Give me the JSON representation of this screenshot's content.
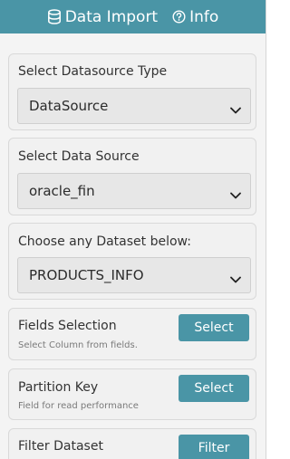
{
  "header": {
    "data_import_label": "Data Import",
    "info_label": "Info",
    "accent_color": "#4a95a6"
  },
  "datasource_type": {
    "label": "Select Datasource Type",
    "selected": "DataSource"
  },
  "data_source": {
    "label": "Select Data Source",
    "selected": "oracle_fin"
  },
  "dataset": {
    "label": "Choose any Dataset below:",
    "selected": "PRODUCTS_INFO"
  },
  "fields_selection": {
    "title": "Fields Selection",
    "subtitle": "Select Column from fields.",
    "button_label": "Select"
  },
  "partition_key": {
    "title": "Partition Key",
    "subtitle": "Field for read performance",
    "button_label": "Select"
  },
  "filter_dataset": {
    "title": "Filter Dataset",
    "button_label": "Filter"
  },
  "icons": {
    "data_import": "database-icon",
    "info": "help-circle-icon",
    "dropdown": "chevron-down-icon"
  }
}
